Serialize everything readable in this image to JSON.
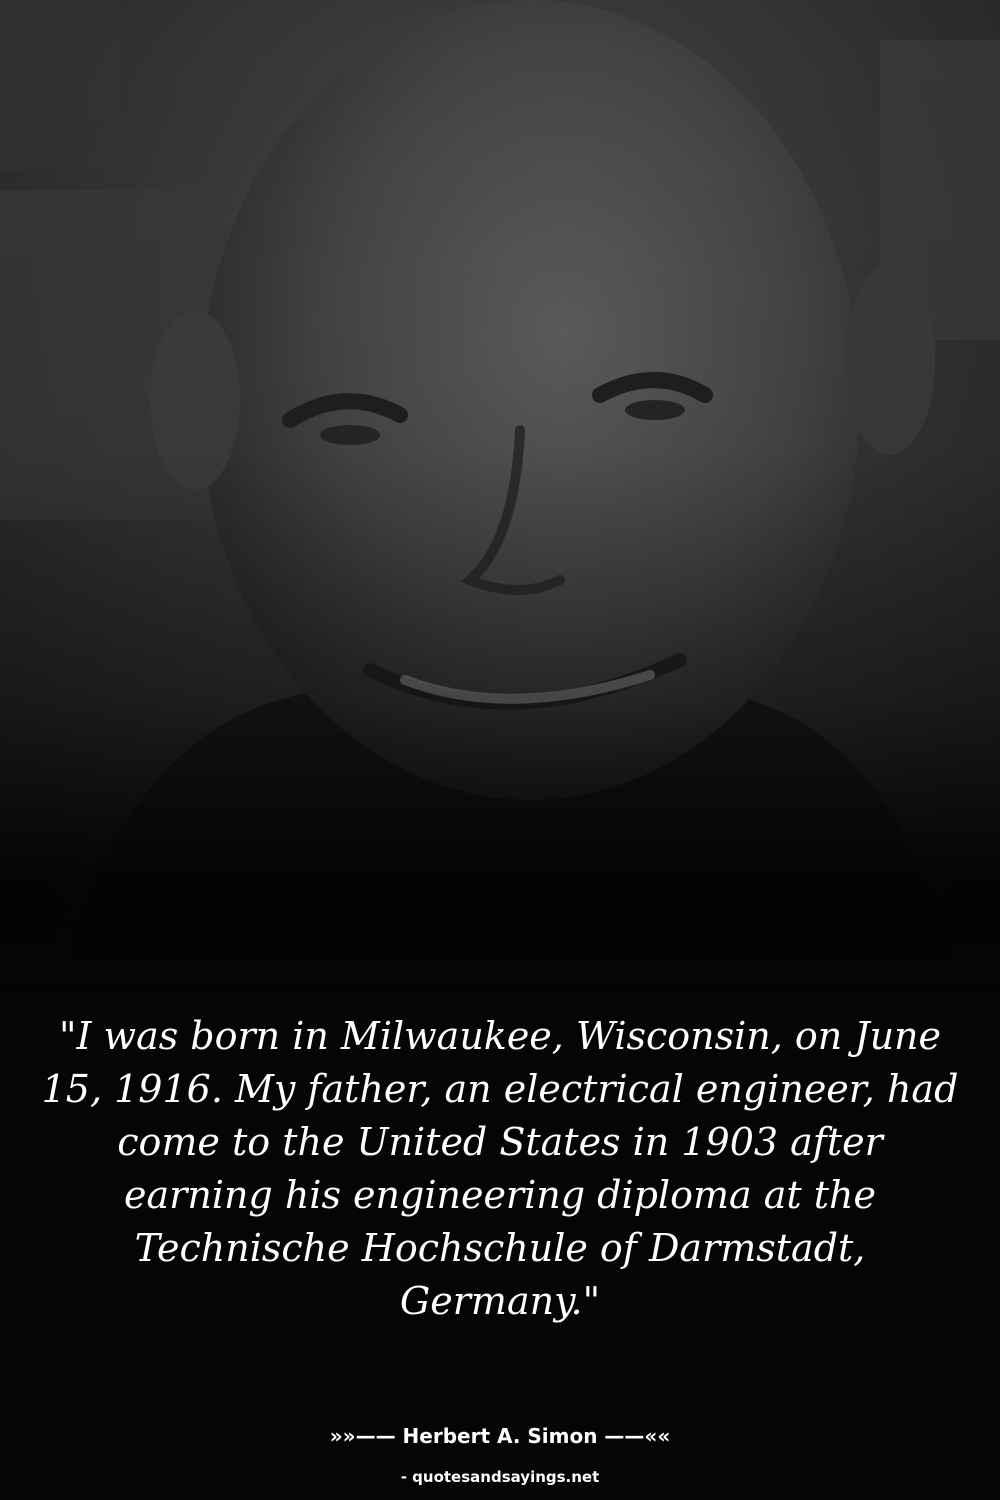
{
  "quote": {
    "text": "\"I was born in Milwaukee, Wisconsin, on June 15, 1916. My father, an electrical engineer, had come to the United States in 1903 after earning his engineering diploma at the Technische Hochschule of Darmstadt, Germany.\""
  },
  "attribution": {
    "author_line": "»»—— Herbert A. Simon ——««",
    "source_line": "- quotesandsayings.net"
  },
  "colors": {
    "background": "#050505",
    "text": "#ffffff"
  }
}
